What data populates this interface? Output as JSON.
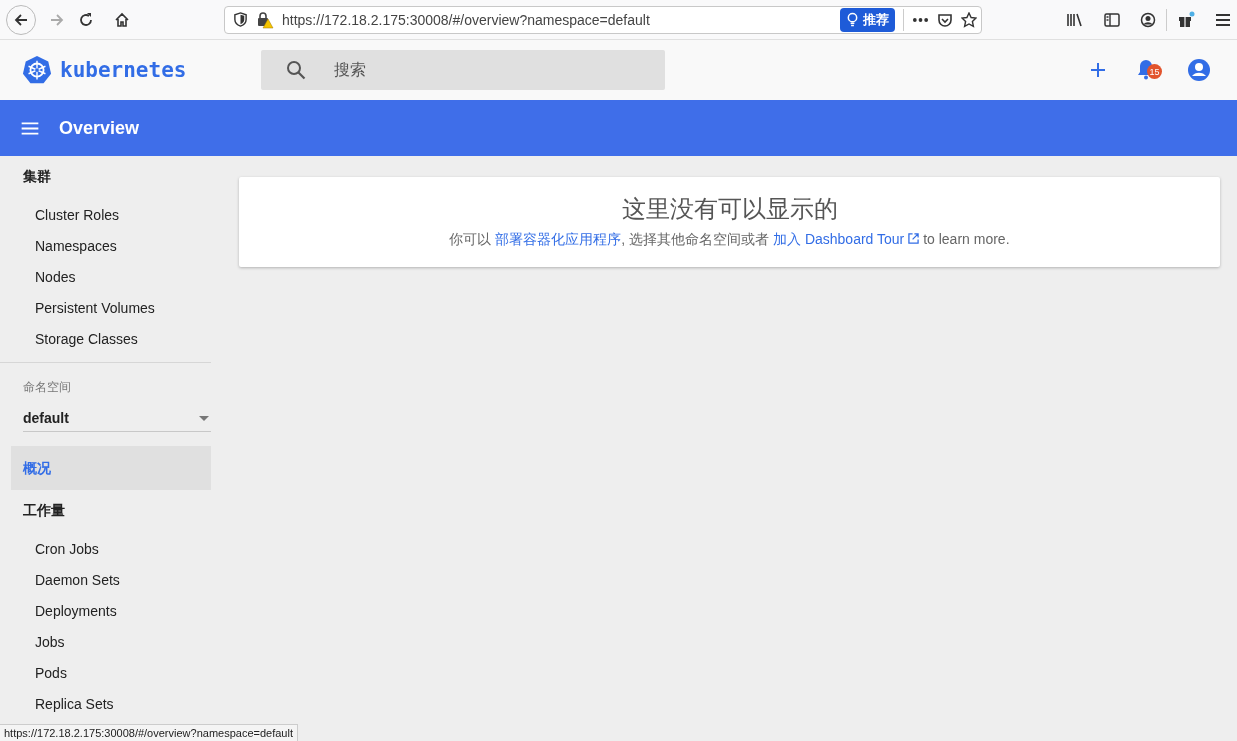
{
  "browser": {
    "url": "https://172.18.2.175:30008/#/overview?namespace=default",
    "suggest_button": "推荐",
    "forward_disabled": true
  },
  "header": {
    "brand": "kubernetes",
    "search": {
      "placeholder": "搜索"
    },
    "notifications": "15"
  },
  "toolbar": {
    "title": "Overview"
  },
  "sidebar": [
    {
      "kind": "section",
      "heading": "集群",
      "items": [
        {
          "label": "Cluster Roles",
          "selected": false
        },
        {
          "label": "Namespaces",
          "selected": false
        },
        {
          "label": "Nodes",
          "selected": false
        },
        {
          "label": "Persistent Volumes",
          "selected": false
        },
        {
          "label": "Storage Classes",
          "selected": false
        }
      ]
    },
    {
      "kind": "namespace",
      "label": "命名空间",
      "value": "default"
    },
    {
      "kind": "link",
      "label": "概况",
      "selected": true
    },
    {
      "kind": "section",
      "heading": "工作量",
      "items": [
        {
          "label": "Cron Jobs",
          "selected": false
        },
        {
          "label": "Daemon Sets",
          "selected": false
        },
        {
          "label": "Deployments",
          "selected": false
        },
        {
          "label": "Jobs",
          "selected": false
        },
        {
          "label": "Pods",
          "selected": false
        },
        {
          "label": "Replica Sets",
          "selected": false
        }
      ]
    }
  ],
  "empty_state": {
    "title": "这里没有可以显示的",
    "message": [
      {
        "kind": "text",
        "text": "你可以 "
      },
      {
        "kind": "link",
        "text": "部署容器化应用程序"
      },
      {
        "kind": "text",
        "text": ", 选择其他命名空间或者 "
      },
      {
        "kind": "external_link",
        "text": "加入 Dashboard Tour"
      },
      {
        "kind": "text",
        "text": " to learn more."
      }
    ]
  },
  "status_url": "https://172.18.2.175:30008/#/overview?namespace=default"
}
